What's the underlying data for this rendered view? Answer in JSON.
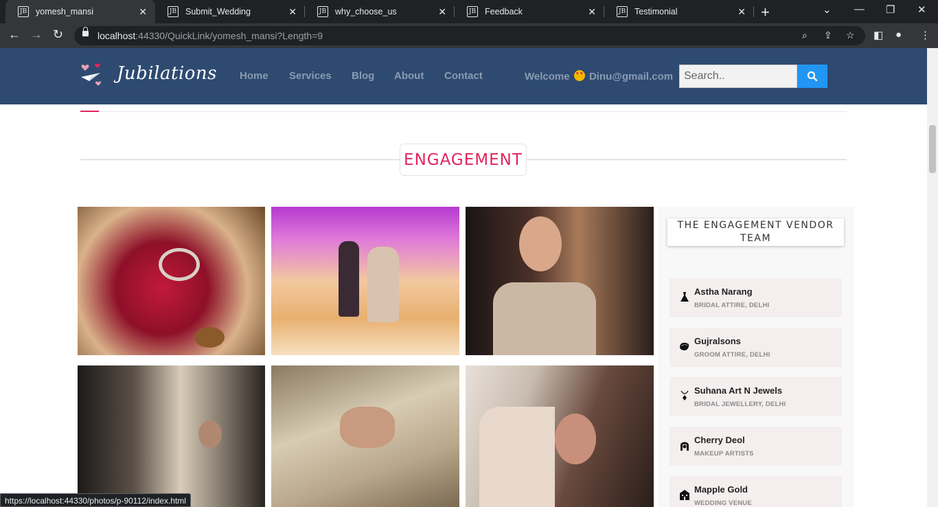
{
  "browser": {
    "tabs": [
      {
        "title": "yomesh_mansi",
        "favicon": "JB",
        "active": true
      },
      {
        "title": "Submit_Wedding",
        "favicon": "JB",
        "active": false
      },
      {
        "title": "why_choose_us",
        "favicon": "JB",
        "active": false
      },
      {
        "title": "Feedback",
        "favicon": "JB",
        "active": false
      },
      {
        "title": "Testimonial",
        "favicon": "JB",
        "active": false
      }
    ],
    "url_host": "localhost",
    "url_rest": ":44330/QuickLink/yomesh_mansi?Length=9",
    "status_url": "https://localhost:44330/photos/p-90112/index.html"
  },
  "header": {
    "logo_text": "Jubilations",
    "nav": [
      "Home",
      "Services",
      "Blog",
      "About",
      "Contact"
    ],
    "welcome_prefix": "Welcome",
    "welcome_user": "Dinu@gmail.com",
    "search_placeholder": "Search.."
  },
  "section": {
    "title": "ENGAGEMENT"
  },
  "photos": [
    {
      "subject": "engagement rings on red flower"
    },
    {
      "subject": "couple dancing with sparklers"
    },
    {
      "subject": "bride in embroidered lehenga smiling"
    },
    {
      "subject": "bride in lehenga, dark backdrop"
    },
    {
      "subject": "hands with engagement rings on lehenga"
    },
    {
      "subject": "bride posing by doorway"
    }
  ],
  "sidebar": {
    "title": "THE ENGAGEMENT VENDOR TEAM",
    "vendors": [
      {
        "name": "Astha Narang",
        "category": "BRIDAL ATTIRE, DELHI",
        "icon": "dress-icon"
      },
      {
        "name": "Gujralsons",
        "category": "GROOM ATTIRE, DELHI",
        "icon": "turban-icon"
      },
      {
        "name": "Suhana Art N Jewels",
        "category": "BRIDAL JEWELLERY, DELHI",
        "icon": "jewel-icon"
      },
      {
        "name": "Cherry Deol",
        "category": "MAKEUP ARTISTS",
        "icon": "makeup-icon"
      },
      {
        "name": "Mapple Gold",
        "category": "WEDDING VENUE",
        "icon": "venue-icon"
      }
    ]
  },
  "colors": {
    "header_bg": "#2e4a70",
    "accent_pink": "#e0245e",
    "search_button": "#2196f3"
  }
}
